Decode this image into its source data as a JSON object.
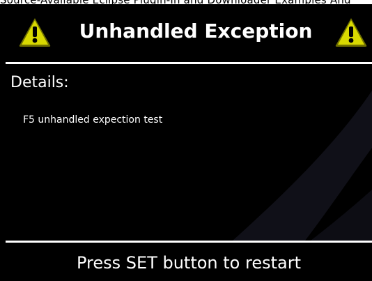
{
  "cropped_top_text": "Source-Available Eclipse Plugin-In and Downloader Examples And",
  "dialog": {
    "title": "Unhandled Exception",
    "left_icon": "warning-triangle-icon",
    "right_icon": "warning-triangle-icon",
    "details_heading": "Details:",
    "details_message": "F5 unhandled expection test",
    "footer_instruction": "Press SET button to restart"
  },
  "colors": {
    "background": "#000000",
    "text": "#ffffff",
    "divider": "#ffffff",
    "warning_fill": "#d8d800",
    "warning_outline": "#6f6f00",
    "warning_glyph": "#000000",
    "swoosh": "#1b1b26"
  }
}
